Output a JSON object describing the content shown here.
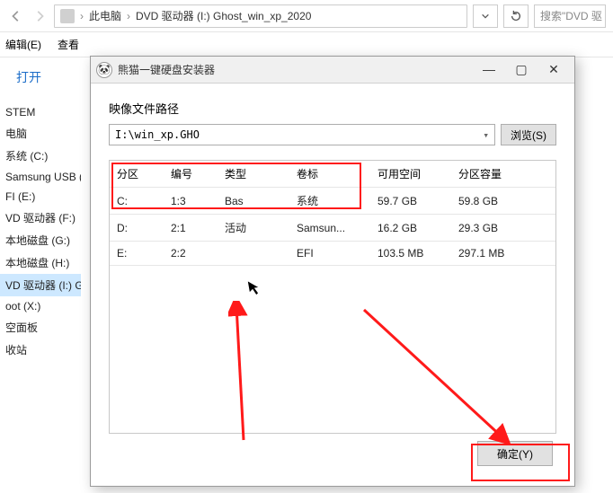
{
  "explorer": {
    "breadcrumb": {
      "root": "此电脑",
      "folder1": "DVD 驱动器 (I:) Ghost_win_xp_2020"
    },
    "search_placeholder": "搜索\"DVD 驱",
    "menu": {
      "edit": "编辑(E)",
      "view": "查看"
    },
    "open_label": "打开"
  },
  "tree": {
    "items": [
      "STEM",
      "电脑",
      "系统 (C:)",
      "Samsung USB (",
      "FI (E:)",
      "VD 驱动器 (F:)",
      "本地磁盘 (G:)",
      "本地磁盘 (H:)",
      "VD 驱动器 (I:) G",
      "oot (X:)",
      "空面板",
      "收站"
    ],
    "selected_index": 8
  },
  "dialog": {
    "title": "熊猫一键硬盘安装器",
    "section_label": "映像文件路径",
    "path_value": "I:\\win_xp.GHO",
    "browse_label": "浏览(S)",
    "headers": {
      "partition": "分区",
      "number": "编号",
      "type": "类型",
      "label": "卷标",
      "free": "可用空间",
      "capacity": "分区容量"
    },
    "rows": [
      {
        "partition": "C:",
        "number": "1:3",
        "type": "Bas",
        "label": "系统",
        "free": "59.7 GB",
        "capacity": "59.8 GB"
      },
      {
        "partition": "D:",
        "number": "2:1",
        "type": "活动",
        "label": "Samsun...",
        "free": "16.2 GB",
        "capacity": "29.3 GB"
      },
      {
        "partition": "E:",
        "number": "2:2",
        "type": "",
        "label": "EFI",
        "free": "103.5 MB",
        "capacity": "297.1 MB"
      }
    ],
    "ok_label": "确定(Y)"
  }
}
